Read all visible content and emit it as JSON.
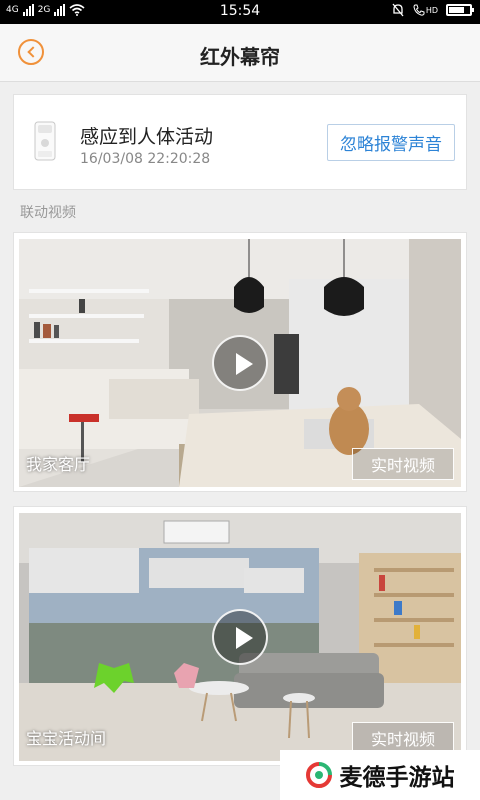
{
  "status_bar": {
    "network_left": "4G",
    "network_right": "2G",
    "time": "15:54",
    "hd_label": "HD",
    "battery_level": 0.75
  },
  "nav": {
    "back_icon": "chevron-left-circle-icon",
    "title": "红外幕帘"
  },
  "alert": {
    "icon": "pir-sensor-icon",
    "title": "感应到人体活动",
    "time": "16/03/08 22:20:28",
    "ignore_button": "忽略报警声音"
  },
  "section": {
    "linked_video_label": "联动视频"
  },
  "videos": [
    {
      "room": "我家客厅",
      "live_button": "实时视频"
    },
    {
      "room": "宝宝活动间",
      "live_button": "实时视频"
    }
  ],
  "watermark": {
    "text": "麦德手游站"
  },
  "colors": {
    "accent_orange": "#f0913a",
    "link_blue": "#2c83d6",
    "background": "#efefef"
  }
}
